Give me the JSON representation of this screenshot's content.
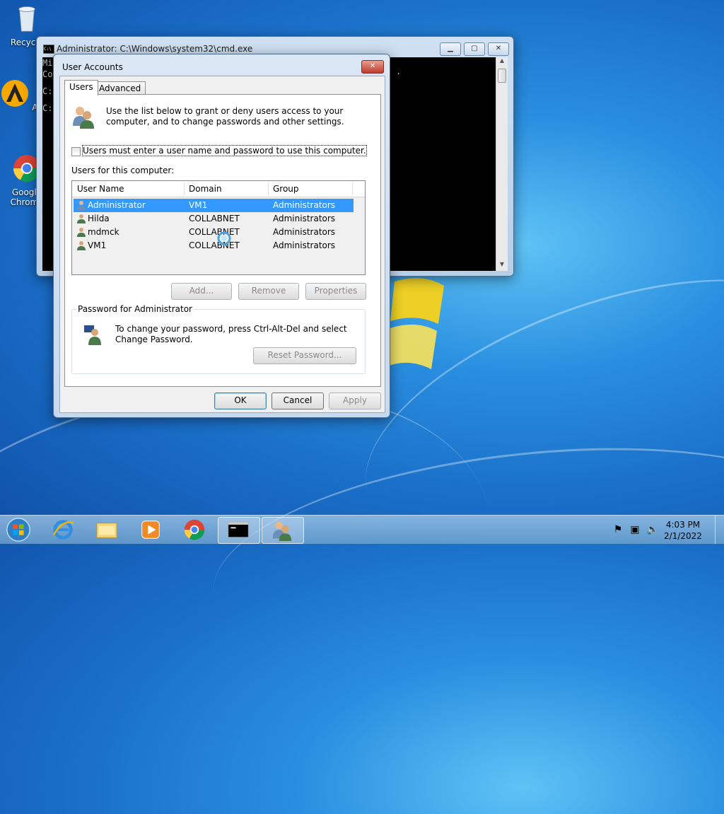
{
  "desktop": {
    "icons": [
      {
        "label": "Recycle",
        "icon": "recycle-bin-icon"
      },
      {
        "label": "AIMP",
        "icon": "aimp-icon"
      },
      {
        "label": "Google Chrome",
        "icon": "chrome-icon"
      }
    ]
  },
  "cmd": {
    "title": "Administrator: C:\\Windows\\system32\\cmd.exe",
    "lines": [
      "Mi",
      "Co",
      "",
      "C:",
      "",
      "C:"
    ],
    "right_text": "."
  },
  "user_accounts": {
    "title": "User Accounts",
    "close_label": "✕",
    "tabs": [
      {
        "label": "Users"
      },
      {
        "label": "Advanced"
      }
    ],
    "intro": "Use the list below to grant or deny users access to your computer, and to change passwords and other settings.",
    "checkbox_label": "Users must enter a user name and password to use this computer.",
    "checkbox_checked": false,
    "list_caption": "Users for this computer:",
    "columns": [
      "User Name",
      "Domain",
      "Group"
    ],
    "rows": [
      {
        "name": "Administrator",
        "domain": "VM1",
        "group": "Administrators"
      },
      {
        "name": "Hilda",
        "domain": "COLLABNET",
        "group": "Administrators"
      },
      {
        "name": "mdmck",
        "domain": "COLLABNET",
        "group": "Administrators"
      },
      {
        "name": "VM1",
        "domain": "COLLABNET",
        "group": "Administrators"
      }
    ],
    "buttons": {
      "add": "Add...",
      "remove": "Remove",
      "properties": "Properties"
    },
    "password_group_label": "Password for Administrator",
    "password_text": "To change your password, press Ctrl-Alt-Del and select Change Password.",
    "reset_password": "Reset Password...",
    "ok": "OK",
    "cancel": "Cancel",
    "apply": "Apply"
  },
  "taskbar": {
    "clock_time": "4:03 PM",
    "clock_date": "2/1/2022"
  }
}
